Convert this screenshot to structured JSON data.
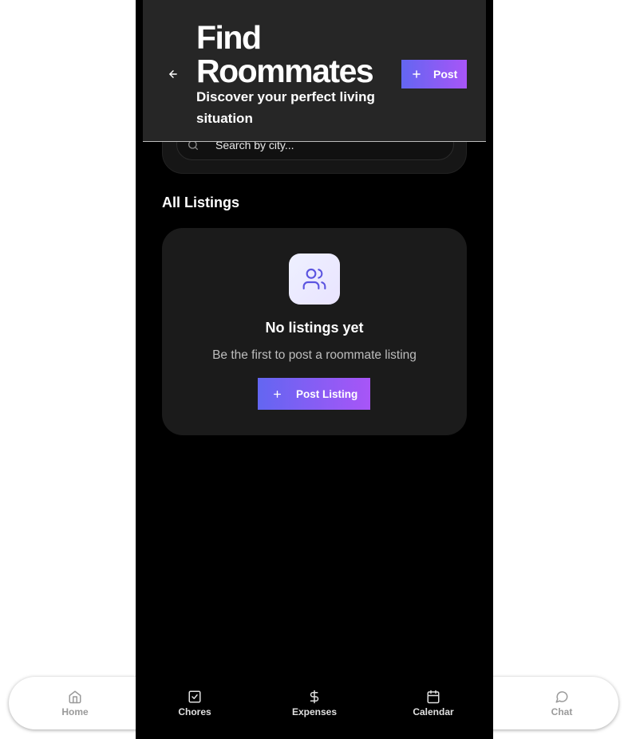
{
  "header": {
    "title": "Find Roommates",
    "subtitle": "Discover your perfect living situation",
    "post_label": "Post",
    "back_icon": "arrow-left-icon",
    "post_icon": "plus-icon"
  },
  "search": {
    "placeholder": "Search by city...",
    "icon": "search-icon"
  },
  "listings": {
    "section_title": "All Listings",
    "empty_icon": "users-icon",
    "empty_title": "No listings yet",
    "empty_subtitle": "Be the first to post a roommate listing",
    "post_listing_label": "Post Listing"
  },
  "tabbar": {
    "items": [
      {
        "label": "Home",
        "icon": "home-icon"
      },
      {
        "label": "Chores",
        "icon": "checkbox-icon"
      },
      {
        "label": "Expenses",
        "icon": "dollar-icon"
      },
      {
        "label": "Calendar",
        "icon": "calendar-icon"
      },
      {
        "label": "Chat",
        "icon": "chat-bubble-icon"
      }
    ]
  },
  "colors": {
    "accent_start": "#6366f1",
    "accent_end": "#a855f7",
    "header_bg": "#262626",
    "screen_bg": "#000000",
    "card_bg": "#1b1b1b"
  }
}
